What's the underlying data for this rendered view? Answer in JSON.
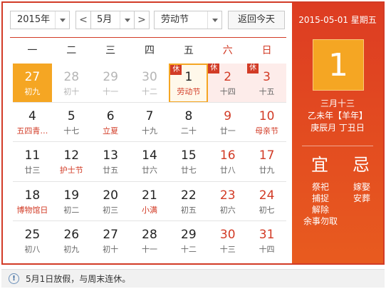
{
  "toolbar": {
    "year": "2015年",
    "month": "5月",
    "holiday": "劳动节",
    "prev": "<",
    "next": ">",
    "today_button": "返回今天"
  },
  "weekdays": [
    "一",
    "二",
    "三",
    "四",
    "五",
    "六",
    "日"
  ],
  "rows": [
    [
      {
        "n": "27",
        "l": "初九",
        "state": "today"
      },
      {
        "n": "28",
        "l": "初十",
        "state": "prev"
      },
      {
        "n": "29",
        "l": "十一",
        "state": "prev"
      },
      {
        "n": "30",
        "l": "十二",
        "state": "prev"
      },
      {
        "n": "1",
        "l": "劳动节",
        "state": "selected",
        "badge": "休"
      },
      {
        "n": "2",
        "l": "十四",
        "state": "holiday",
        "badge": "休",
        "weekend": true
      },
      {
        "n": "3",
        "l": "十五",
        "state": "holiday",
        "badge": "休",
        "weekend": true
      }
    ],
    [
      {
        "n": "4",
        "l": "五四青…",
        "festival": true
      },
      {
        "n": "5",
        "l": "十七"
      },
      {
        "n": "6",
        "l": "立夏",
        "festival": true
      },
      {
        "n": "7",
        "l": "十九"
      },
      {
        "n": "8",
        "l": "二十"
      },
      {
        "n": "9",
        "l": "廿一",
        "weekend": true
      },
      {
        "n": "10",
        "l": "母亲节",
        "weekend": true,
        "festival": true
      }
    ],
    [
      {
        "n": "11",
        "l": "廿三"
      },
      {
        "n": "12",
        "l": "护士节",
        "festival": true
      },
      {
        "n": "13",
        "l": "廿五"
      },
      {
        "n": "14",
        "l": "廿六"
      },
      {
        "n": "15",
        "l": "廿七"
      },
      {
        "n": "16",
        "l": "廿八",
        "weekend": true
      },
      {
        "n": "17",
        "l": "廿九",
        "weekend": true
      }
    ],
    [
      {
        "n": "18",
        "l": "博物馆日",
        "festival": true
      },
      {
        "n": "19",
        "l": "初二"
      },
      {
        "n": "20",
        "l": "初三"
      },
      {
        "n": "21",
        "l": "小满",
        "festival": true
      },
      {
        "n": "22",
        "l": "初五"
      },
      {
        "n": "23",
        "l": "初六",
        "weekend": true
      },
      {
        "n": "24",
        "l": "初七",
        "weekend": true
      }
    ],
    [
      {
        "n": "25",
        "l": "初八"
      },
      {
        "n": "26",
        "l": "初九"
      },
      {
        "n": "27",
        "l": "初十"
      },
      {
        "n": "28",
        "l": "十一"
      },
      {
        "n": "29",
        "l": "十二"
      },
      {
        "n": "30",
        "l": "十三",
        "weekend": true
      },
      {
        "n": "31",
        "l": "十四",
        "weekend": true
      }
    ]
  ],
  "detail": {
    "date_heading": "2015-05-01 星期五",
    "big_day": "1",
    "lunar_date": "三月十三",
    "year_ganzhi": "乙未年【羊年】",
    "month_day_ganzhi": "庚辰月 丁丑日",
    "yi_label": "宜",
    "ji_label": "忌",
    "yi_items": [
      "祭祀",
      "捕捉",
      "解除",
      "余事勿取"
    ],
    "ji_items": [
      "嫁娶",
      "安葬"
    ]
  },
  "note": {
    "text": "5月1日放假，与周末连休。",
    "icon": "info-icon"
  },
  "colors": {
    "accent_red": "#d23b26",
    "today_orange": "#f5a623",
    "holiday_bg": "#fdecea"
  }
}
